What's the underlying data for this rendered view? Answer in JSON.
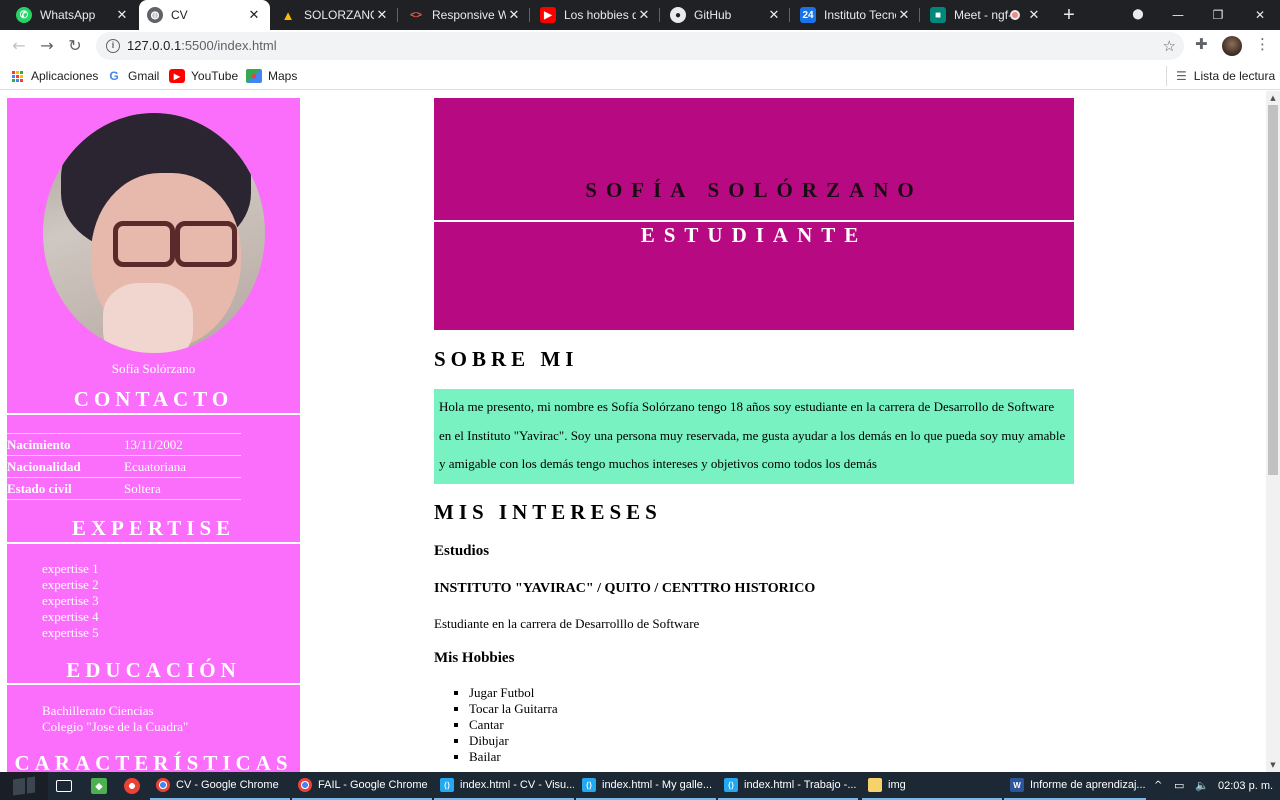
{
  "browser": {
    "tabs": [
      {
        "title": "WhatsApp",
        "icon": "whatsapp-icon",
        "color": "#25d366",
        "glyph": "◔",
        "active": false
      },
      {
        "title": "CV",
        "icon": "globe-icon",
        "color": "#5f6368",
        "glyph": "◍",
        "active": true
      },
      {
        "title": "SOLORZANO MARCILLO SOFIA",
        "icon": "google-drive-icon",
        "color": "#fbbc04",
        "glyph": "▲",
        "active": false
      },
      {
        "title": "Responsive Web Design",
        "icon": "code-icon",
        "color": "#d93025",
        "glyph": "<>",
        "active": false
      },
      {
        "title": "Los hobbies que",
        "icon": "youtube-icon",
        "color": "#ff0000",
        "glyph": "▶",
        "active": false
      },
      {
        "title": "GitHub",
        "icon": "github-icon",
        "color": "#e8eaed",
        "glyph": "●",
        "active": false
      },
      {
        "title": "Instituto Tecnológico",
        "icon": "calendar-icon",
        "color": "#1a73e8",
        "glyph": "24",
        "active": false
      },
      {
        "title": "Meet - ngf-",
        "icon": "meet-icon",
        "color": "#00897b",
        "glyph": "■",
        "active": false
      }
    ],
    "url_host": "127.0.0.1",
    "url_path": ":5500/index.html",
    "bookmarks": [
      {
        "label": "Aplicaciones",
        "icon": "apps-grid-icon"
      },
      {
        "label": "Gmail",
        "icon": "google-g-icon"
      },
      {
        "label": "YouTube",
        "icon": "youtube-icon"
      },
      {
        "label": "Maps",
        "icon": "maps-icon"
      }
    ],
    "reading_list": "Lista de lectura"
  },
  "sidebar": {
    "name": "Sofía Solórzano",
    "contact_title": "CONTACTO",
    "info": [
      {
        "key": "Nacimiento",
        "value": "13/11/2002"
      },
      {
        "key": "Nacionalidad",
        "value": "Ecuatoriana"
      },
      {
        "key": "Estado civil",
        "value": "Soltera"
      }
    ],
    "expertise_title": "EXPERTISE",
    "expertise": [
      "expertise 1",
      "expertise 2",
      "expertise 3",
      "expertise 4",
      "expertise 5"
    ],
    "education_title": "EDUCACIÓN",
    "education": [
      "Bachillerato Ciencias",
      "Colegio \"Jose de la Cuadra\""
    ],
    "features_title": "CARACTERÍSTICAS"
  },
  "main": {
    "hero_name": "SOFÍA SOLÓRZANO",
    "hero_role": "ESTUDIANTE",
    "about_title": "SOBRE MI",
    "about_text": "Hola me presento, mi nombre es Sofía Solórzano tengo 18 años soy estudiante en la carrera de Desarrollo de Software en el Instituto \"Yavirac\". Soy una persona muy reservada, me gusta ayudar a los demás en lo que pueda soy muy amable y amigable con los demás tengo muchos intereses y objetivos como todos los demás",
    "interests_title": "MIS INTERESES",
    "studies_title": "Estudios",
    "institute": "INSTITUTO \"YAVIRAC\" / QUITO / CENTTRO HISTORICO",
    "career": "Estudiante en la carrera de Desarrolllo de Software",
    "hobbies_title": "Mis Hobbies",
    "hobbies": [
      "Jugar Futbol",
      "Tocar la Guitarra",
      "Cantar",
      "Dibujar",
      "Bailar"
    ]
  },
  "taskbar": {
    "items": [
      {
        "label": "CV - Google Chrome",
        "icon": "chrome-icon"
      },
      {
        "label": "FAIL - Google Chrome",
        "icon": "chrome-icon"
      },
      {
        "label": "index.html - CV - Visu...",
        "icon": "vscode-icon"
      },
      {
        "label": "index.html - My galle...",
        "icon": "vscode-icon"
      },
      {
        "label": "index.html - Trabajo -...",
        "icon": "vscode-icon"
      },
      {
        "label": "img",
        "icon": "folder-icon"
      },
      {
        "label": "Informe de aprendizaj...",
        "icon": "word-icon"
      }
    ],
    "time": "02:03 p. m."
  },
  "colors": {
    "sidebar_bg": "#fb6dfb",
    "hero_bg": "#b70a82",
    "about_bg": "#79f2c1"
  }
}
